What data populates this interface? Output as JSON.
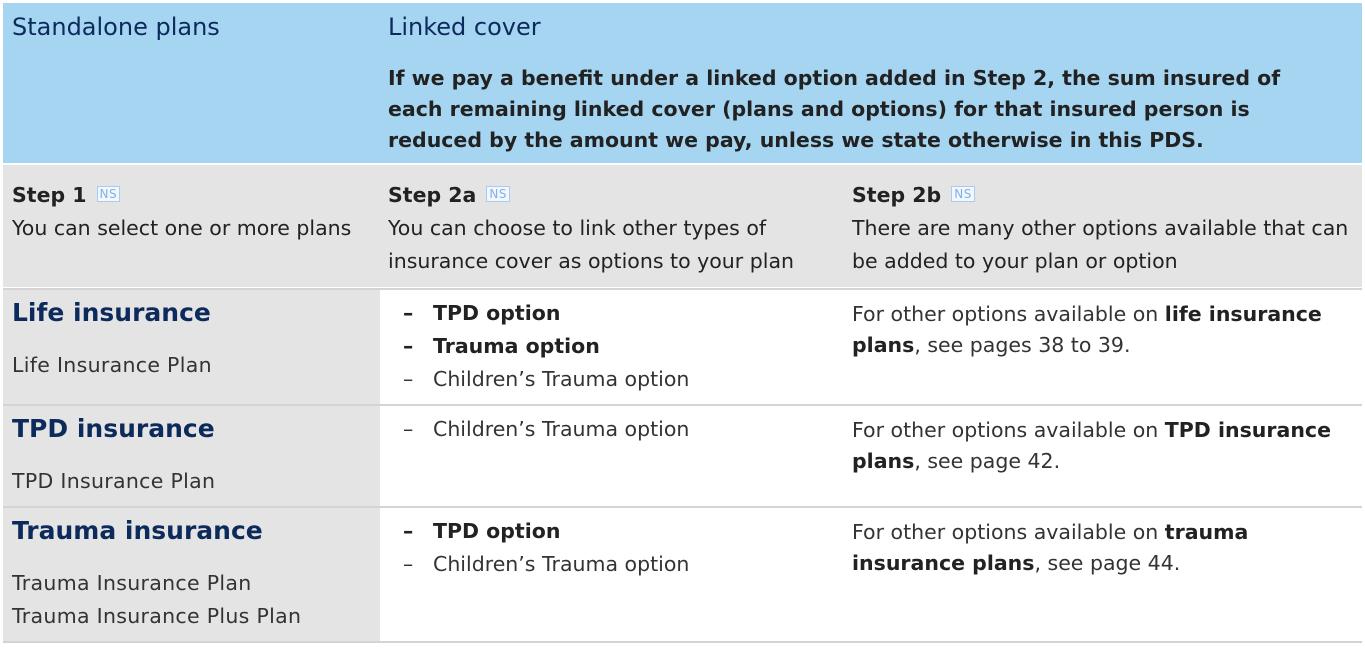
{
  "header": {
    "left_title": "Standalone plans",
    "right_title": "Linked cover",
    "note": "If we pay a benefit under a linked option added in Step 2, the sum insured of each remaining linked cover (plans and options) for that insured person is reduced by the amount we pay, unless we state otherwise in this PDS."
  },
  "steps": [
    {
      "name": "Step 1",
      "badge": "NS",
      "desc": "You can select one or more plans"
    },
    {
      "name": "Step 2a",
      "badge": "NS",
      "desc": "You can choose to link other types of insurance cover as options to your plan"
    },
    {
      "name": "Step 2b",
      "badge": "NS",
      "desc": "There are many other options available that can be added to your plan or option"
    }
  ],
  "rows": [
    {
      "title": "Life insurance",
      "plans": [
        "Life Insurance Plan"
      ],
      "options": [
        {
          "dash": "–",
          "label": "TPD option"
        },
        {
          "dash": "–",
          "label": "Trauma option"
        },
        {
          "dash": "–",
          "label": "Children’s Trauma option"
        }
      ],
      "other": {
        "pre": "For other options available on ",
        "bold": "life insurance plans",
        "post": ", see pages 38 to 39."
      }
    },
    {
      "title": "TPD insurance",
      "plans": [
        "TPD Insurance Plan"
      ],
      "options": [
        {
          "dash": "–",
          "label": "Children’s Trauma option"
        }
      ],
      "other": {
        "pre": "For other options available on ",
        "bold": "TPD insurance plans",
        "post": ", see page 42."
      }
    },
    {
      "title": "Trauma insurance",
      "plans": [
        "Trauma Insurance Plan",
        "Trauma Insurance Plus Plan"
      ],
      "options": [
        {
          "dash": "–",
          "label": "TPD option"
        },
        {
          "dash": "–",
          "label": "Children’s Trauma option"
        }
      ],
      "other": {
        "pre": "For other options available on ",
        "bold": "trauma insurance plans",
        "post": ", see page 44."
      }
    }
  ]
}
